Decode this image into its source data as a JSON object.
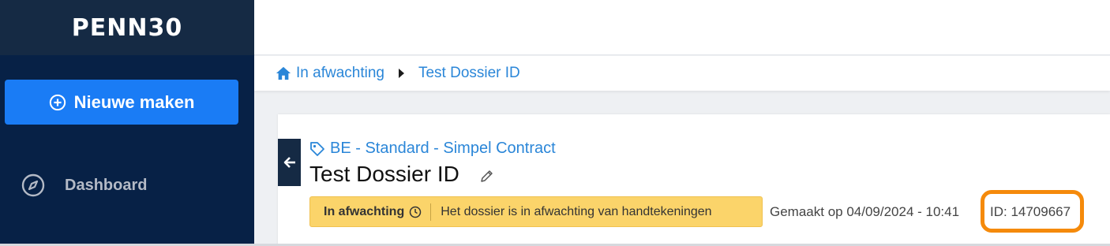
{
  "brand": {
    "logo_text": "PENN30"
  },
  "sidebar": {
    "new_button_label": "Nieuwe maken",
    "items": [
      {
        "label": "Dashboard",
        "icon": "compass-icon"
      }
    ]
  },
  "breadcrumb": {
    "items": [
      {
        "label": "In afwachting",
        "icon": "home-icon"
      },
      {
        "label": "Test Dossier ID"
      }
    ]
  },
  "dossier": {
    "template": "BE - Standard - Simpel Contract",
    "title": "Test Dossier ID",
    "status_label": "In afwachting",
    "status_message": "Het dossier is in afwachting van handtekeningen",
    "created": "Gemaakt op 04/09/2024 - 10:41",
    "id_text": "ID: 14709667"
  },
  "colors": {
    "sidebar": "#072146",
    "brand_bar": "#152a44",
    "primary": "#1a7cf5",
    "link": "#2a86d8",
    "status_bg": "#fbd46a",
    "highlight": "#f58a0b"
  }
}
